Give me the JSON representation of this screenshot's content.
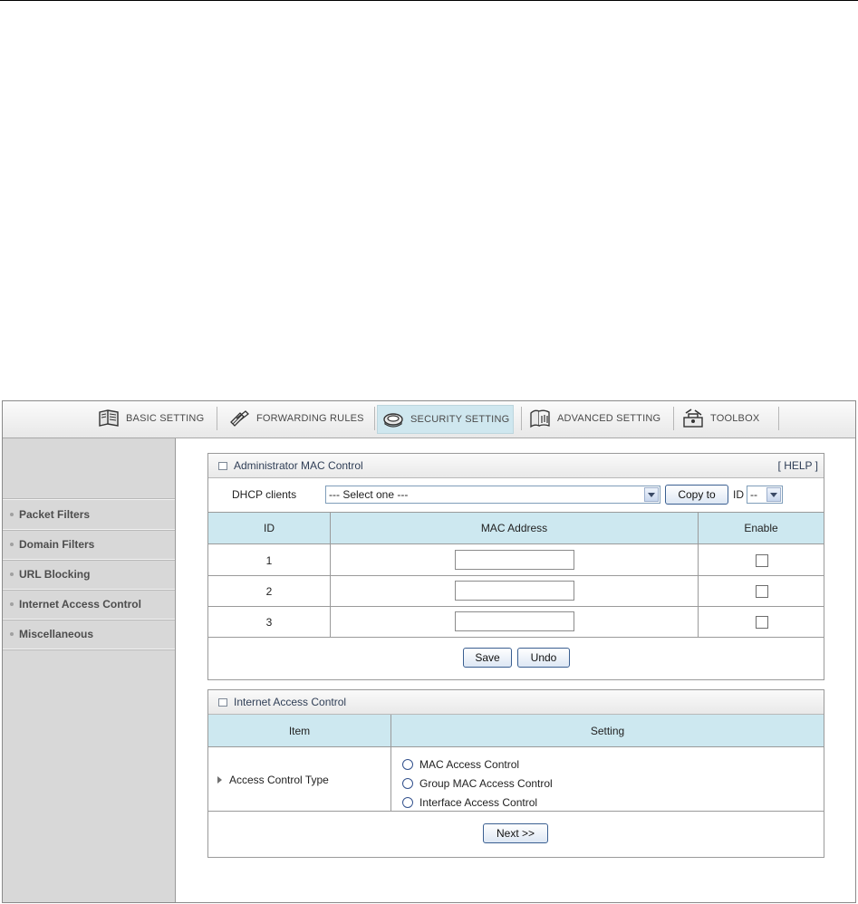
{
  "nav": {
    "items": [
      {
        "label": "BASIC SETTING",
        "icon": "basic-setting-icon",
        "active": false
      },
      {
        "label": "FORWARDING RULES",
        "icon": "forwarding-rules-icon",
        "active": false
      },
      {
        "label": "SECURITY SETTING",
        "icon": "security-setting-icon",
        "active": true
      },
      {
        "label": "ADVANCED SETTING",
        "icon": "advanced-setting-icon",
        "active": false
      },
      {
        "label": "TOOLBOX",
        "icon": "toolbox-icon",
        "active": false
      }
    ]
  },
  "sidebar": {
    "items": [
      {
        "label": "Packet Filters"
      },
      {
        "label": "Domain Filters"
      },
      {
        "label": "URL Blocking"
      },
      {
        "label": "Internet Access Control"
      },
      {
        "label": "Miscellaneous"
      }
    ]
  },
  "mac_control": {
    "title": "Administrator MAC Control",
    "help": "[ HELP ]",
    "dhcp_label": "DHCP clients",
    "dhcp_select": "--- Select one ---",
    "copy_to": "Copy to",
    "id_label": "ID",
    "id_select": "--",
    "columns": [
      "ID",
      "MAC Address",
      "Enable"
    ],
    "rows": [
      {
        "id": "1",
        "mac": "",
        "enabled": false
      },
      {
        "id": "2",
        "mac": "",
        "enabled": false
      },
      {
        "id": "3",
        "mac": "",
        "enabled": false
      }
    ],
    "save": "Save",
    "undo": "Undo"
  },
  "access_control": {
    "title": "Internet Access Control",
    "columns": [
      "Item",
      "Setting"
    ],
    "item_label": "Access Control Type",
    "options": [
      "MAC Access Control",
      "Group MAC Access Control",
      "Interface Access Control"
    ],
    "next": "Next >>"
  },
  "colors": {
    "header_cell_bg": "#cde8f0",
    "active_tab_bg": "#cfe7ef",
    "sidebar_bg": "#d8d8d8"
  }
}
